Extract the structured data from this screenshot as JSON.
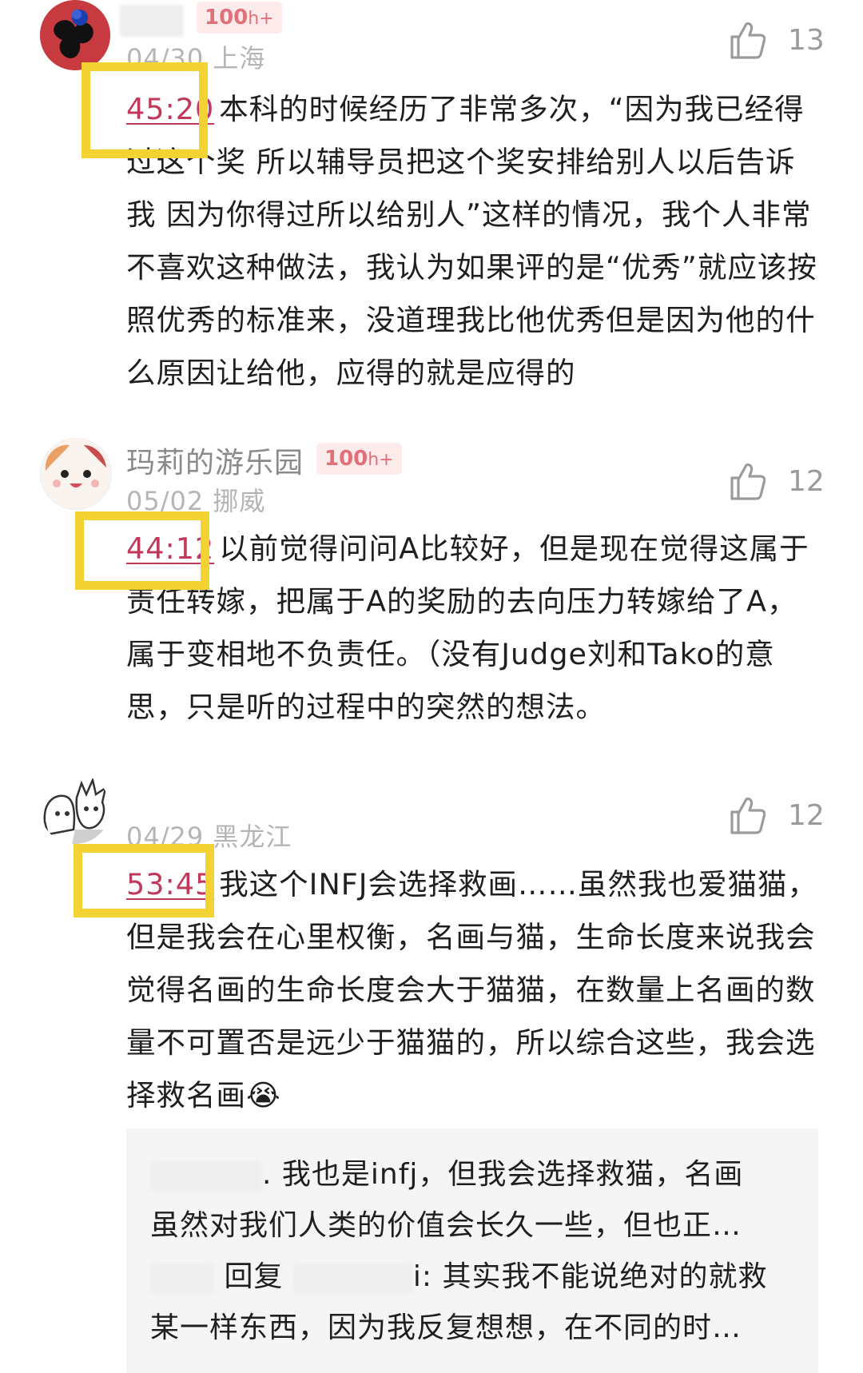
{
  "comments": [
    {
      "username": "",
      "badge_num": "100",
      "badge_suffix": "h+",
      "date": "04/30",
      "location": "上海",
      "likes": "13",
      "timestamp": "45:20",
      "text": "本科的时候经历了非常多次，“因为我已经得过这个奖 所以辅导员把这个奖安排给别人以后告诉我 因为你得过所以给别人”这样的情况，我个人非常不喜欢这种做法，我认为如果评的是“优秀”就应该按照优秀的标准来，没道理我比他优秀但是因为他的什么原因让给他，应得的就是应得的"
    },
    {
      "username": "玛莉的游乐园",
      "badge_num": "100",
      "badge_suffix": "h+",
      "date": "05/02",
      "location": "挪威",
      "likes": "12",
      "timestamp": "44:12",
      "text": "以前觉得问问A比较好，但是现在觉得这属于责任转嫁，把属于A的奖励的去向压力转嫁给了A，属于变相地不负责任。（没有Judge刘和Tako的意思，只是听的过程中的突然的想法。"
    },
    {
      "username": "",
      "date": "04/29",
      "location": "黑龙江",
      "likes": "12",
      "timestamp": "53:45",
      "text": "我这个INFJ会选择救画……虽然我也爱猫猫，但是我会在心里权衡，名画与猫，生命长度来说我会觉得名画的生命长度会大于猫猫，在数量上名画的数量不可置否是远少于猫猫的，所以综合这些，我会选择救名画😭",
      "replies": [
        {
          "line1": ". 我也是infj，但我会选择救猫，名画",
          "line2": "虽然对我们人类的价值会长久一些，但也正…"
        },
        {
          "reply_word": "回复",
          "line1": "i: 其实我不能说绝对的就救",
          "line2": "某一样东西，因为我反复想想，在不同的时…"
        }
      ]
    }
  ],
  "colors": {
    "highlight_frame": "#f3d233",
    "timestamp": "#c0395b",
    "badge_bg": "#fdeaea",
    "badge_text": "#e0707a"
  },
  "icons": {
    "like": "thumbs-up-icon"
  }
}
